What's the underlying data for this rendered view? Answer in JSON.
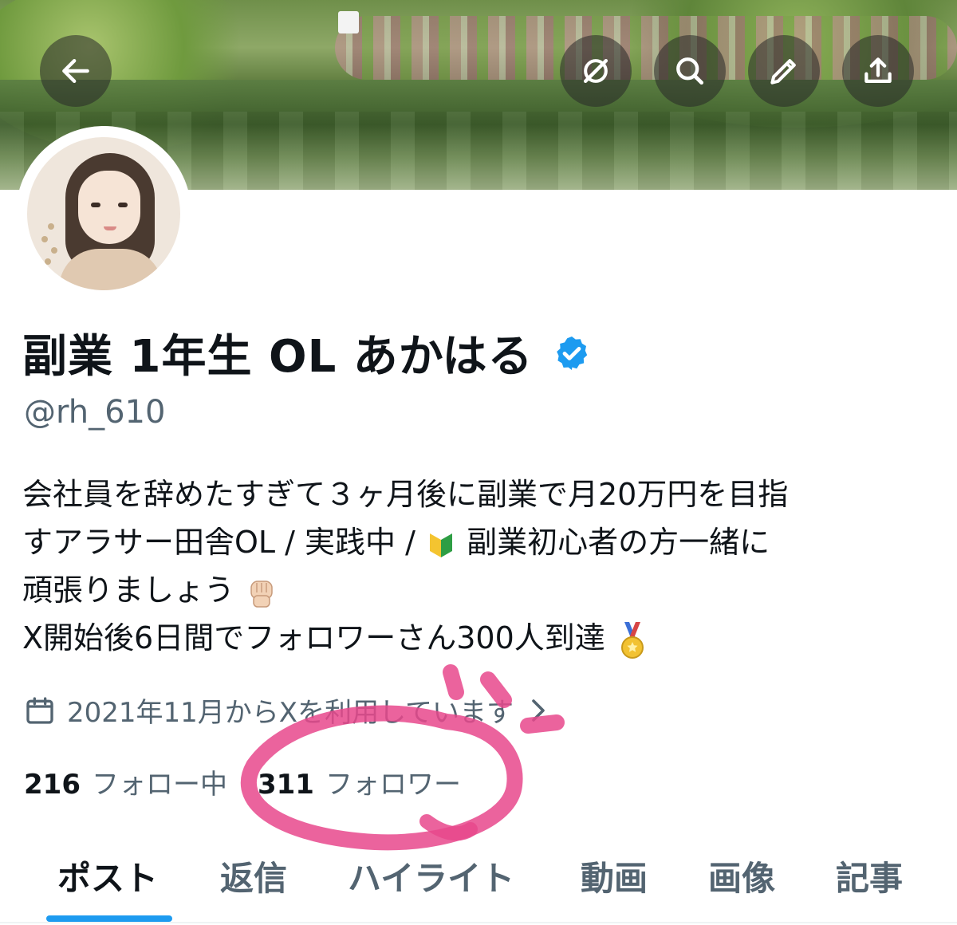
{
  "header": {
    "back_icon": "arrow-left-icon",
    "actions": [
      "grok-icon",
      "search-icon",
      "edit-icon",
      "share-icon"
    ]
  },
  "profile": {
    "name": "副業 1年生 OL あかはる",
    "handle": "@rh_610",
    "verified_color": "#1d9bf0",
    "bio_lines": [
      "会社員を辞めたすぎて３ヶ月後に副業で月20万円を目指",
      "すアラサー田舎OL / 実践中 /",
      "副業初心者の方一緒に",
      "頑張りましょう",
      "X開始後6日間でフォロワーさん300人到達"
    ],
    "joined": "2021年11月からXを利用しています",
    "following_count": "216",
    "following_label": "フォロー中",
    "followers_count": "311",
    "followers_label": "フォロワー"
  },
  "tabs": [
    {
      "label": "ポスト",
      "active": true
    },
    {
      "label": "返信"
    },
    {
      "label": "ハイライト"
    },
    {
      "label": "動画"
    },
    {
      "label": "画像"
    },
    {
      "label": "記事"
    }
  ],
  "colors": {
    "accent": "#1d9bf0",
    "annotation": "#e8488c",
    "secondary_text": "#536471"
  }
}
